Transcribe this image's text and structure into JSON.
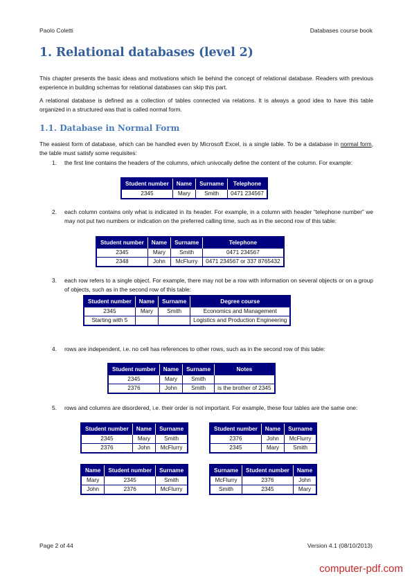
{
  "header": {
    "author": "Paolo Coletti",
    "book": "Databases course book"
  },
  "chapter_title": "1. Relational databases (level 2)",
  "intro_paragraphs": [
    "This chapter presents the basic ideas and motivations which lie behind the concept of relational database. Readers with previous experience in building schemas for relational databases can skip this part.",
    "A relational database is defined as a collection of tables connected via relations. It is always a good idea to have this table organized in a structured was that is called normal form."
  ],
  "section_title": "1.1. Database in Normal Form",
  "section_intro": {
    "before": "The easiest form of database, which can be handled even by Microsoft Excel, is a single table. To be a database in ",
    "link": "normal form",
    "after": ", the table must satisfy some requisites:"
  },
  "requisites": [
    {
      "num": "1.",
      "text": "the first line contains the headers of the columns, which univocally define the content of the column. For example:"
    },
    {
      "num": "2.",
      "text": "each column contains only what is indicated in its header. For example, in a column with header “telephone number” we may not put two numbers or indication on the preferred calling time, such as in the second row of this table:"
    },
    {
      "num": "3.",
      "text": "each row refers to a single object. For example, there may not be a row with information on several objects or on a group of objects, such as in the second row of this table:"
    },
    {
      "num": "4.",
      "text": "rows are independent, i.e. no cell has references to other rows, such as in the second row of this table:"
    },
    {
      "num": "5.",
      "text": "rows and columns are disordered, i.e. their order is not important. For example, these four tables are the same one:"
    }
  ],
  "tables": {
    "t1": {
      "headers": [
        "Student number",
        "Name",
        "Surname",
        "Telephone"
      ],
      "rows": [
        [
          "2345",
          "Mary",
          "Smith",
          "0471 234567"
        ]
      ]
    },
    "t2": {
      "headers": [
        "Student number",
        "Name",
        "Surname",
        "Telephone"
      ],
      "rows": [
        [
          "2345",
          "Mary",
          "Smith",
          "0471 234567"
        ],
        [
          "2348",
          "John",
          "McFlurry",
          "0471 234567 or 337 8765432"
        ]
      ]
    },
    "t3": {
      "headers": [
        "Student number",
        "Name",
        "Surname",
        "Degree course"
      ],
      "rows": [
        [
          "2345",
          "Mary",
          "Smith",
          "Economics and Management"
        ],
        [
          "Starting with 5",
          "",
          "",
          "Logistics and Production Engineering"
        ]
      ]
    },
    "t4": {
      "headers": [
        "Student number",
        "Name",
        "Surname",
        "Notes"
      ],
      "rows": [
        [
          "2345",
          "Mary",
          "Smith",
          ""
        ],
        [
          "2376",
          "John",
          "Smith",
          "is the brother of 2345"
        ]
      ]
    },
    "t5a": {
      "headers": [
        "Student number",
        "Name",
        "Surname"
      ],
      "rows": [
        [
          "2345",
          "Mary",
          "Smith"
        ],
        [
          "2376",
          "John",
          "McFlurry"
        ]
      ]
    },
    "t5b": {
      "headers": [
        "Student number",
        "Name",
        "Surname"
      ],
      "rows": [
        [
          "2376",
          "John",
          "McFlurry"
        ],
        [
          "2345",
          "Mary",
          "Smith"
        ]
      ]
    },
    "t5c": {
      "headers": [
        "Name",
        "Student number",
        "Surname"
      ],
      "rows": [
        [
          "Mary",
          "2345",
          "Smith"
        ],
        [
          "John",
          "2376",
          "McFlurry"
        ]
      ]
    },
    "t5d": {
      "headers": [
        "Surname",
        "Student number",
        "Name"
      ],
      "rows": [
        [
          "McFlurry",
          "2376",
          "John"
        ],
        [
          "Smith",
          "2345",
          "Mary"
        ]
      ]
    }
  },
  "footer": {
    "page": "Page 2 of 44",
    "version": "Version 4.1 (08/10/2013)"
  },
  "watermark": "computer-pdf.com",
  "colors": {
    "heading": "#36609a",
    "subheading": "#4a7ab8",
    "table_header": "#000080",
    "watermark": "#c0282a"
  }
}
